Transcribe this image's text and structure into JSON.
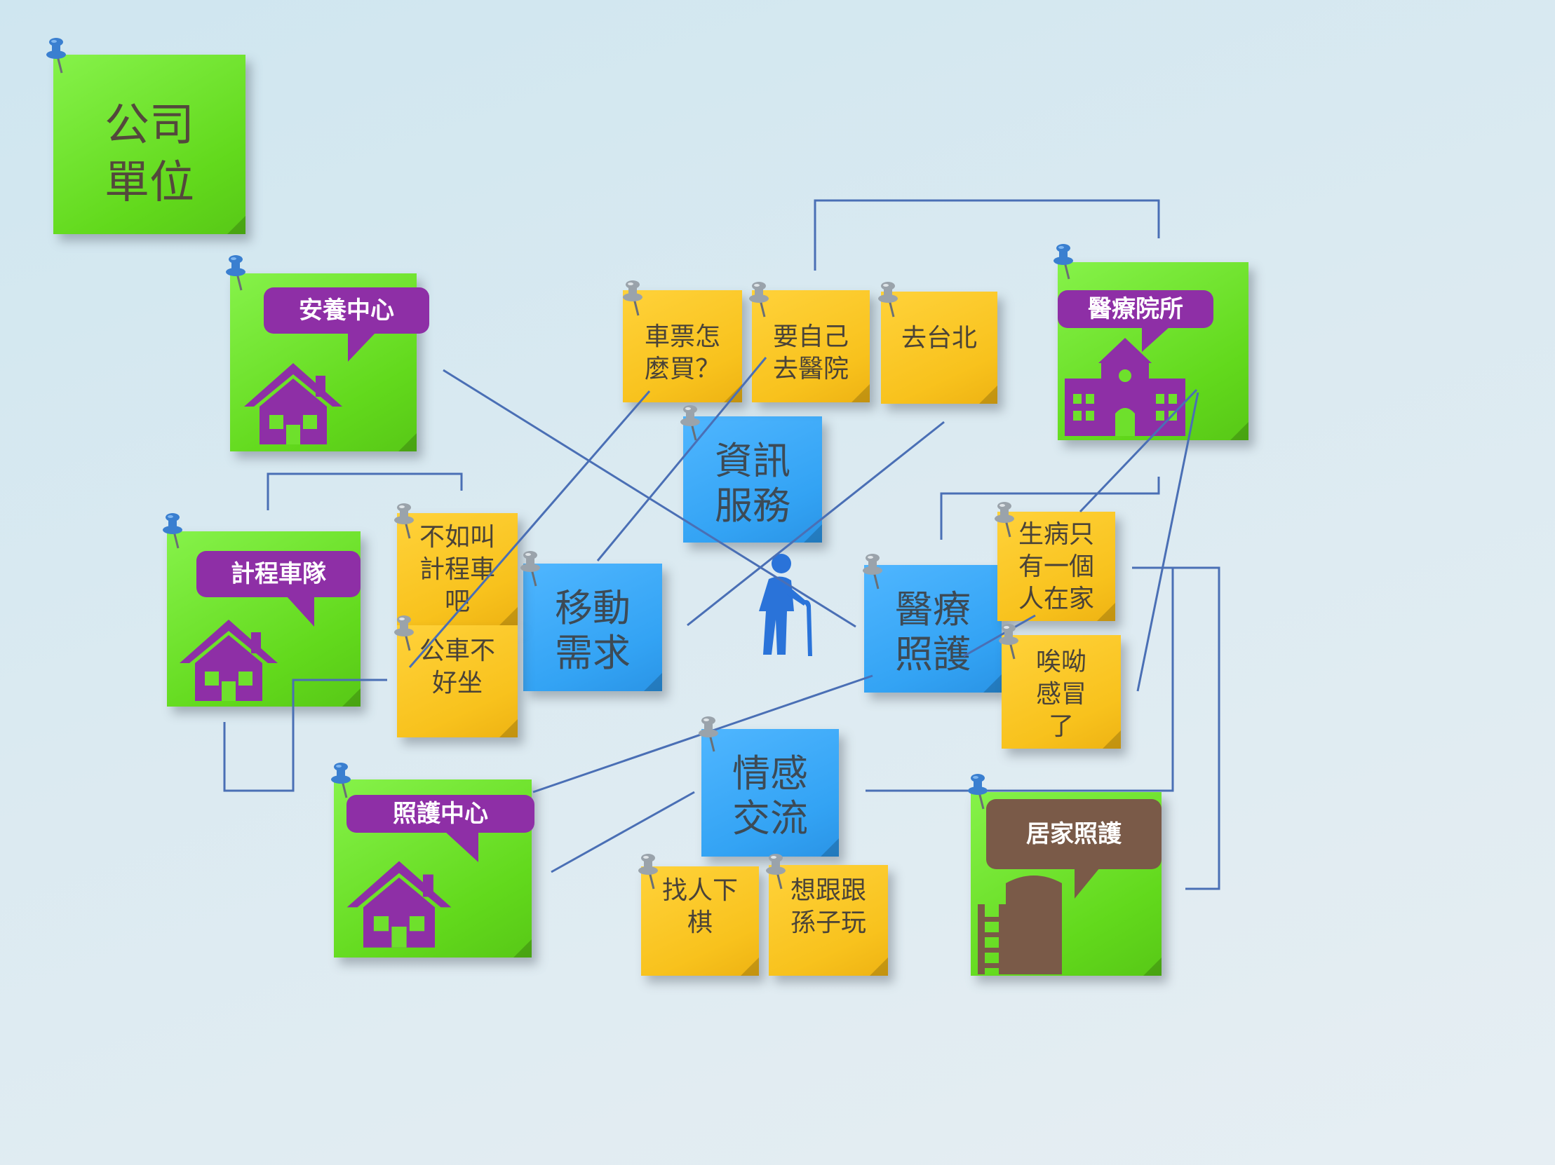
{
  "header_note": {
    "line1": "公司",
    "line2": "單位"
  },
  "companies": {
    "nursing_home": "安養中心",
    "taxi_team": "計程車隊",
    "care_center": "照護中心",
    "hospital": "醫療院所",
    "home_care": "居家照護"
  },
  "categories": {
    "info_service": "資訊\n服務",
    "mobility_need": "移動\n需求",
    "medical_care": "醫療\n照護",
    "emotional_exchange": "情感\n交流"
  },
  "needs": {
    "ticket": "車票怎\n麼買？",
    "go_hospital": "要自己\n去醫院",
    "go_taipei": "去台北",
    "call_taxi": "不如叫\n計程車\n吧",
    "bus_hard": "公車不\n好坐",
    "sick_alone": "生病只\n有一個\n人在家",
    "cold": "唉呦\n感冒\n了",
    "chess": "找人下\n棋",
    "grandkids": "想跟跟\n孫子玩"
  },
  "colors": {
    "company_note": "#6ee02c",
    "need_note": "#f8c21d",
    "category_note": "#33a3f4",
    "label_bubble": "#8e2fa6",
    "home_care_bubble": "#7a5a48",
    "connector_line": "#4a6fb5",
    "elderly_icon": "#2a73d9"
  },
  "icons": [
    "pushpin-icon",
    "house-icon",
    "hospital-building-icon",
    "elderly-person-icon",
    "house-with-ladder-icon"
  ]
}
